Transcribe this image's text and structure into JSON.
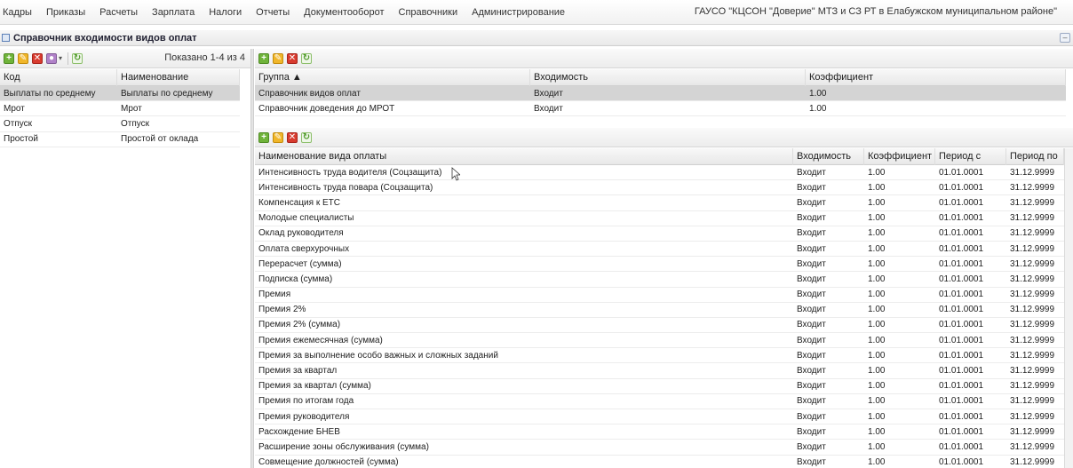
{
  "menu": {
    "items": [
      "Кадры",
      "Приказы",
      "Расчеты",
      "Зарплата",
      "Налоги",
      "Отчеты",
      "Документооборот",
      "Справочники",
      "Администрирование"
    ],
    "organization": "ГАУСО \"КЦСОН \"Доверие\" МТЗ и СЗ РТ в Елабужском муниципальном районе\""
  },
  "window": {
    "title": "Справочник входимости видов оплат",
    "minimize_label": "–"
  },
  "left": {
    "count_label": "Показано 1-4 из 4",
    "columns": [
      "Код",
      "Наименование"
    ],
    "rows": [
      [
        "Выплаты по среднему",
        "Выплаты по среднему"
      ],
      [
        "Мрот",
        "Мрот"
      ],
      [
        "Отпуск",
        "Отпуск"
      ],
      [
        "Простой",
        "Простой от оклада"
      ]
    ],
    "selected_row": 0
  },
  "groups": {
    "columns": [
      "Группа ▲",
      "Входимость",
      "Коэффициент"
    ],
    "rows": [
      [
        "Справочник видов оплат",
        "Входит",
        "1.00"
      ],
      [
        "Справочник доведения до МРОТ",
        "Входит",
        "1.00"
      ]
    ],
    "selected_row": 0
  },
  "payments": {
    "columns": [
      "Наименование вида оплаты",
      "Входимость",
      "Коэффициент",
      "Период с",
      "Период по"
    ],
    "rows": [
      [
        "Интенсивность труда водителя (Соцзащита)",
        "Входит",
        "1.00",
        "01.01.0001",
        "31.12.9999"
      ],
      [
        "Интенсивность труда повара (Соцзащита)",
        "Входит",
        "1.00",
        "01.01.0001",
        "31.12.9999"
      ],
      [
        "Компенсация к ЕТС",
        "Входит",
        "1.00",
        "01.01.0001",
        "31.12.9999"
      ],
      [
        "Молодые специалисты",
        "Входит",
        "1.00",
        "01.01.0001",
        "31.12.9999"
      ],
      [
        "Оклад руководителя",
        "Входит",
        "1.00",
        "01.01.0001",
        "31.12.9999"
      ],
      [
        "Оплата сверхурочных",
        "Входит",
        "1.00",
        "01.01.0001",
        "31.12.9999"
      ],
      [
        "Перерасчет (сумма)",
        "Входит",
        "1.00",
        "01.01.0001",
        "31.12.9999"
      ],
      [
        "Подписка (сумма)",
        "Входит",
        "1.00",
        "01.01.0001",
        "31.12.9999"
      ],
      [
        "Премия",
        "Входит",
        "1.00",
        "01.01.0001",
        "31.12.9999"
      ],
      [
        "Премия 2%",
        "Входит",
        "1.00",
        "01.01.0001",
        "31.12.9999"
      ],
      [
        "Премия 2% (сумма)",
        "Входит",
        "1.00",
        "01.01.0001",
        "31.12.9999"
      ],
      [
        "Премия ежемесячная (сумма)",
        "Входит",
        "1.00",
        "01.01.0001",
        "31.12.9999"
      ],
      [
        "Премия за выполнение особо важных и сложных заданий",
        "Входит",
        "1.00",
        "01.01.0001",
        "31.12.9999"
      ],
      [
        "Премия за квартал",
        "Входит",
        "1.00",
        "01.01.0001",
        "31.12.9999"
      ],
      [
        "Премия за квартал (сумма)",
        "Входит",
        "1.00",
        "01.01.0001",
        "31.12.9999"
      ],
      [
        "Премия по итогам года",
        "Входит",
        "1.00",
        "01.01.0001",
        "31.12.9999"
      ],
      [
        "Премия руководителя",
        "Входит",
        "1.00",
        "01.01.0001",
        "31.12.9999"
      ],
      [
        "Расхождение БНЕВ",
        "Входит",
        "1.00",
        "01.01.0001",
        "31.12.9999"
      ],
      [
        "Расширение зоны обслуживания (сумма)",
        "Входит",
        "1.00",
        "01.01.0001",
        "31.12.9999"
      ],
      [
        "Совмещение должностей (сумма)",
        "Входит",
        "1.00",
        "01.01.0001",
        "31.12.9999"
      ]
    ]
  },
  "icons": {
    "add": "+",
    "edit": "✎",
    "delete": "✕",
    "misc": "●",
    "refresh": "↻",
    "dropdown": "▾"
  }
}
